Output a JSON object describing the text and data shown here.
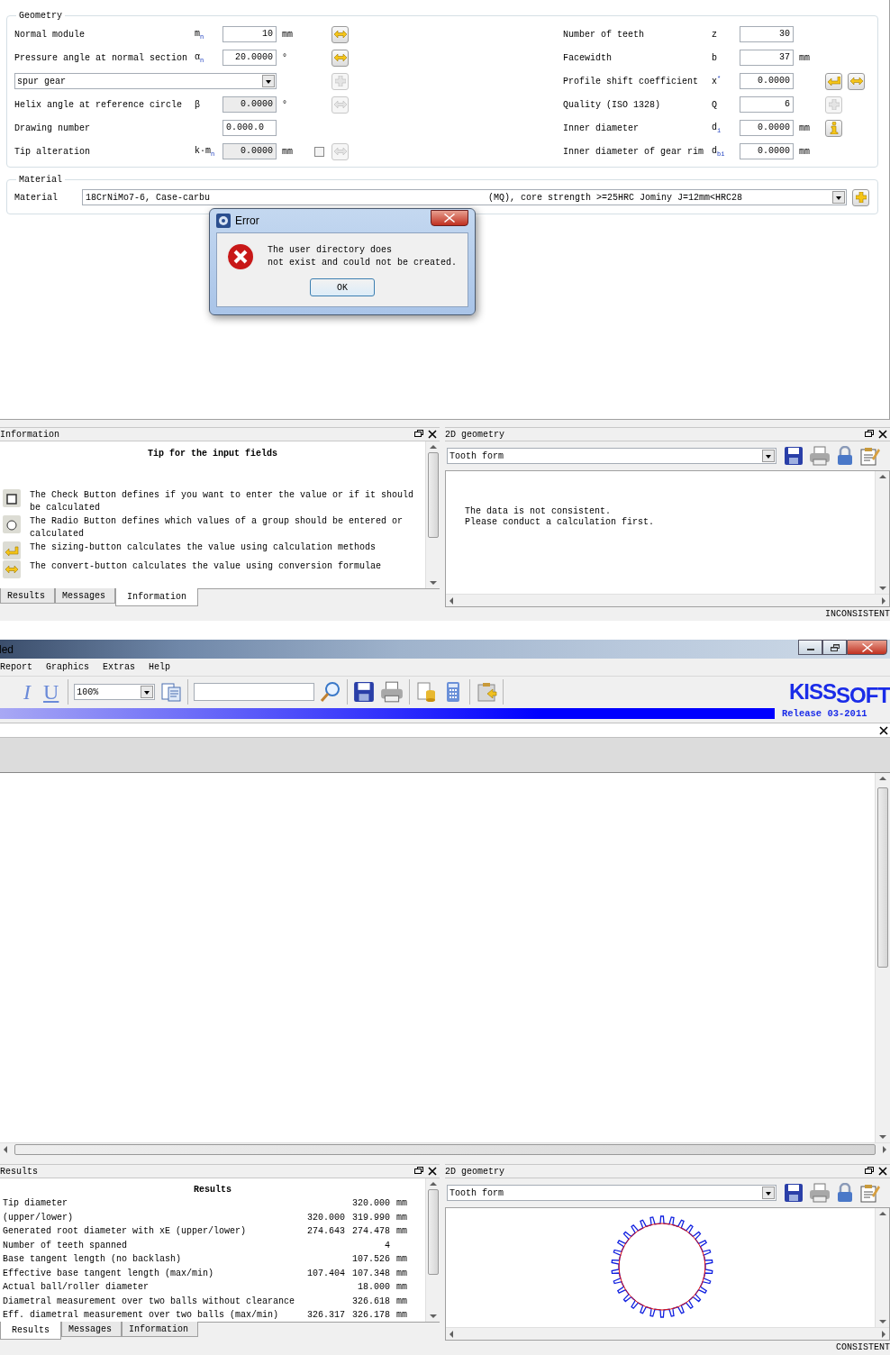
{
  "upper_window": {
    "geometry": {
      "title": "Geometry",
      "left_rows": [
        {
          "kind": "field",
          "label": "Normal module",
          "symbol": "m$_{n}$",
          "value": "10",
          "unit": "mm",
          "disabled": false,
          "buttons": [
            {
              "kind": "convert",
              "disabled": false
            }
          ]
        },
        {
          "kind": "field",
          "label": "Pressure angle at normal section",
          "symbol": "α$_{n}$",
          "value": "20.0000",
          "unit": "°",
          "disabled": false,
          "buttons": [
            {
              "kind": "convert",
              "disabled": false
            }
          ]
        },
        {
          "kind": "select",
          "value": "spur gear",
          "buttons": [
            {
              "kind": "plus",
              "disabled": true
            }
          ]
        },
        {
          "kind": "field",
          "label": "Helix angle at reference circle",
          "symbol": "β",
          "value": "0.0000",
          "unit": "°",
          "disabled": true,
          "buttons": [
            {
              "kind": "convert",
              "disabled": true
            }
          ]
        },
        {
          "kind": "text",
          "label": "Drawing number",
          "value": "0.000.0",
          "disabled": false
        },
        {
          "kind": "field",
          "label": "Tip alteration",
          "symbol": "k·m$_{n}$",
          "value": "0.0000",
          "unit": "mm",
          "disabled": true,
          "checked": false,
          "buttons": [
            {
              "kind": "convert",
              "disabled": true
            }
          ]
        }
      ],
      "right_rows": [
        {
          "label": "Number of teeth",
          "symbol": "z",
          "value": "30",
          "disabled": false
        },
        {
          "label": "Facewidth",
          "symbol": "b",
          "value": "37",
          "unit": "mm",
          "disabled": false
        },
        {
          "label": "Profile shift coefficient",
          "symbol": "x$^{*}$",
          "value": "0.0000",
          "disabled": false,
          "buttons": [
            {
              "kind": "sizing",
              "disabled": false
            },
            {
              "kind": "convert",
              "disabled": false
            }
          ]
        },
        {
          "label": "Quality (ISO 1328)",
          "symbol": "Q",
          "value": "6",
          "disabled": false,
          "buttons": [
            {
              "kind": "plus",
              "disabled": true
            }
          ]
        },
        {
          "label": "Inner diameter",
          "symbol": "d$_{i}$",
          "value": "0.0000",
          "unit": "mm",
          "disabled": false,
          "buttons": [
            {
              "kind": "info",
              "disabled": false
            }
          ]
        },
        {
          "label": "Inner diameter of gear rim",
          "symbol": "d$_{bi}$",
          "value": "0.0000",
          "unit": "mm",
          "disabled": false
        }
      ]
    },
    "material": {
      "title": "Material",
      "label": "Material",
      "value_start": "18CrNiMo7-6, Case-carbu",
      "value_end": "(MQ), core strength >=25HRC Jominy J=12mm<HRC28",
      "button": {
        "kind": "plus",
        "disabled": false
      }
    },
    "error_dialog": {
      "title": "Error",
      "message_lines": [
        "The user directory does",
        "not exist and could not be created."
      ],
      "button": "OK"
    },
    "info_panel": {
      "title": "Information",
      "heading": "Tip for the input fields",
      "tips": [
        {
          "kind": "checkbox",
          "text": "The Check Button defines if you want to enter the value or if it should be calculated"
        },
        {
          "kind": "radio",
          "text": "The Radio Button defines which values of a group should be entered or calculated"
        },
        {
          "kind": "sizing",
          "text": "The sizing-button calculates the value using calculation methods"
        },
        {
          "kind": "convert",
          "text": "The convert-button calculates the value using conversion formulae"
        }
      ],
      "tabs": [
        {
          "label": "Results",
          "selected": false
        },
        {
          "label": "Messages",
          "selected": false
        },
        {
          "label": "Information",
          "selected": true
        }
      ]
    },
    "geometry_panel": {
      "title": "2D geometry",
      "view": "Tooth form",
      "message_lines": [
        "The data is not consistent.",
        "Please conduct a calculation first."
      ]
    },
    "status": "INCONSISTENT"
  },
  "lower_window": {
    "title": "led",
    "menu": [
      "Report",
      "Graphics",
      "Extras",
      "Help"
    ],
    "format_buttons": [
      "I",
      "U"
    ],
    "zoom": "100%",
    "logo": {
      "first": "KISS",
      "second": "SOFT"
    },
    "release": "Release 03-2011",
    "results_panel": {
      "title": "Results",
      "heading": "Results",
      "rows": [
        {
          "label": "Tip diameter",
          "values": [
            "320.000"
          ],
          "unit": "mm"
        },
        {
          "label": "(upper/lower)",
          "values": [
            "320.000",
            "319.990"
          ],
          "unit": "mm"
        },
        {
          "label": "Generated root diameter with xE (upper/lower)",
          "values": [
            "274.643",
            "274.478"
          ],
          "unit": "mm"
        },
        {
          "label": "Number of teeth spanned",
          "values": [
            "4"
          ]
        },
        {
          "label": "Base tangent length (no backlash)",
          "values": [
            "107.526"
          ],
          "unit": "mm"
        },
        {
          "label": "Effective base tangent length (max/min)",
          "values": [
            "107.404",
            "107.348"
          ],
          "unit": "mm"
        },
        {
          "label": "Actual ball/roller diameter",
          "values": [
            "18.000"
          ],
          "unit": "mm"
        },
        {
          "label": "Diametral measurement over two balls without clearance",
          "values": [
            "326.618"
          ],
          "unit": "mm"
        },
        {
          "label": "Eff. diametral measurement over two balls (max/min)",
          "values": [
            "326.317",
            "326.178"
          ],
          "unit": "mm"
        }
      ],
      "tabs": [
        {
          "label": "Results",
          "selected": true
        },
        {
          "label": "Messages",
          "selected": false
        },
        {
          "label": "Information",
          "selected": false
        }
      ]
    },
    "geometry_panel": {
      "title": "2D geometry",
      "view": "Tooth form"
    },
    "status": "CONSISTENT"
  }
}
